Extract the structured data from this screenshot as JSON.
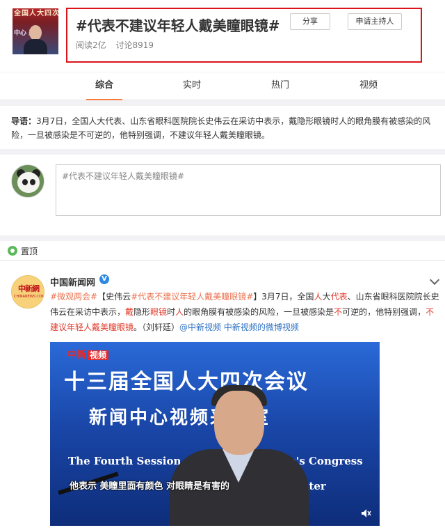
{
  "header": {
    "title": "#代表不建议年轻人戴美瞳眼镜#",
    "reads": "阅读2亿",
    "discussions": "讨论8919",
    "share_label": "分享",
    "apply_host_label": "申请主持人",
    "thumb_line1": "全国人大四次",
    "thumb_line2": "中心 采访"
  },
  "tabs": [
    {
      "label": "综合",
      "active": true
    },
    {
      "label": "实时",
      "active": false
    },
    {
      "label": "热门",
      "active": false
    },
    {
      "label": "视频",
      "active": false
    }
  ],
  "intro": {
    "prefix": "导语：",
    "text": "3月7日，全国人大代表、山东省眼科医院院长史伟云在采访中表示，戴隐形眼镜时人的眼角膜有被感染的风险，一旦被感染是不可逆的，他特别强调，不建议年轻人戴美瞳眼镜。"
  },
  "composer": {
    "placeholder": "#代表不建议年轻人戴美瞳眼镜#"
  },
  "pinned": {
    "label": "置顶"
  },
  "post": {
    "author": "中国新闻网",
    "avatar_logo": "中新網",
    "avatar_sub": "CHINANEWS.COM",
    "parts": [
      {
        "t": "#微观两会#",
        "c": "link"
      },
      {
        "t": "【史伟云",
        "c": ""
      },
      {
        "t": "#代表不建议年轻人戴美瞳眼镜#",
        "c": "link"
      },
      {
        "t": "】3月7日，全国",
        "c": ""
      },
      {
        "t": "人",
        "c": "hl"
      },
      {
        "t": "大",
        "c": ""
      },
      {
        "t": "代表",
        "c": "hl"
      },
      {
        "t": "、山东省眼科医院院长史伟云在采访中表示，",
        "c": ""
      },
      {
        "t": "戴",
        "c": "hl"
      },
      {
        "t": "隐形",
        "c": ""
      },
      {
        "t": "眼镜",
        "c": "hl"
      },
      {
        "t": "时",
        "c": ""
      },
      {
        "t": "人",
        "c": "hl"
      },
      {
        "t": "的眼角膜有被感染的风险，一旦被感染是",
        "c": ""
      },
      {
        "t": "不",
        "c": "hl"
      },
      {
        "t": "可逆的，他特别强调，",
        "c": ""
      },
      {
        "t": "不建议年轻人戴美瞳眼镜",
        "c": "hl"
      },
      {
        "t": "。（刘轩廷）",
        "c": ""
      },
      {
        "t": "@中新视频",
        "c": "blue"
      },
      {
        "t": " ",
        "c": ""
      },
      {
        "t": "中新视频的微博视频",
        "c": "blue"
      }
    ],
    "video": {
      "watermark_brand": "中新",
      "watermark_tag": "视频",
      "line1": "十三届全国人大四次会议",
      "line2": "新闻中心视频采访室",
      "line3": "The Fourth Session of",
      "line3b": "ople's Congress",
      "line4": "Center",
      "caption": "他表示 美瞳里面有颜色 对眼睛是有害的"
    }
  },
  "colors": {
    "accent": "#fa7d3c",
    "highlight_box": "#d9151b",
    "link": "#eb7350",
    "keyword": "#e23b2b",
    "blue_link": "#2f72c3"
  }
}
